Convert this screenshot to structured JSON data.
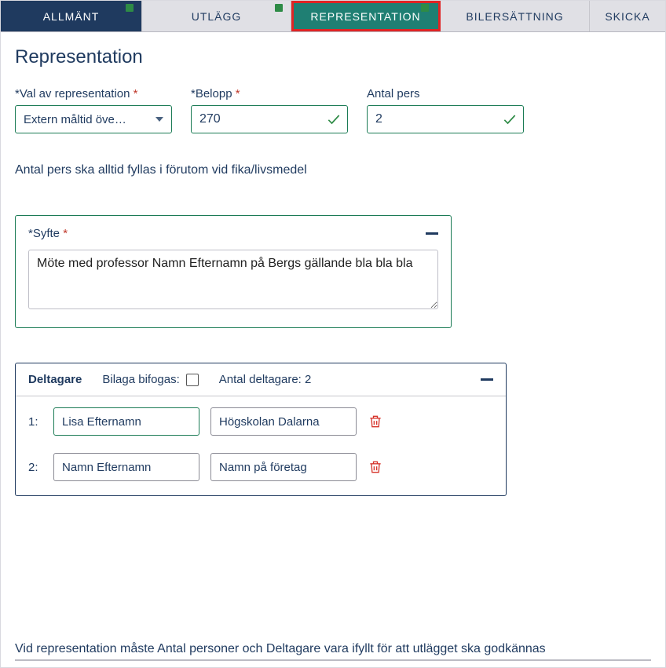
{
  "tabs": {
    "allmant": "Allmänt",
    "utlagg": "Utlägg",
    "representation": "Representation",
    "bilersattning": "Bilersättning",
    "skicka": "Skicka"
  },
  "page_title": "Representation",
  "fields": {
    "val_label": "*Val av representation",
    "val_value": "Extern måltid öve…",
    "belopp_label": "*Belopp",
    "belopp_value": "270",
    "antal_label": "Antal pers",
    "antal_value": "2"
  },
  "note": "Antal pers ska alltid fyllas i förutom vid fika/livsmedel",
  "syfte": {
    "label": "*Syfte",
    "value": "Möte med professor Namn Efternamn på Bergs gällande bla bla bla"
  },
  "deltagare": {
    "title": "Deltagare",
    "bilaga_label": "Bilaga bifogas:",
    "antal_label": "Antal deltagare: 2",
    "rows": [
      {
        "index": "1:",
        "name": "Lisa Efternamn",
        "org": "Högskolan Dalarna"
      },
      {
        "index": "2:",
        "name": "Namn Efternamn",
        "org": "Namn på företag"
      }
    ]
  },
  "footer": "Vid representation måste Antal personer och Deltagare vara ifyllt för att utlägget ska godkännas",
  "asterisk": "*"
}
